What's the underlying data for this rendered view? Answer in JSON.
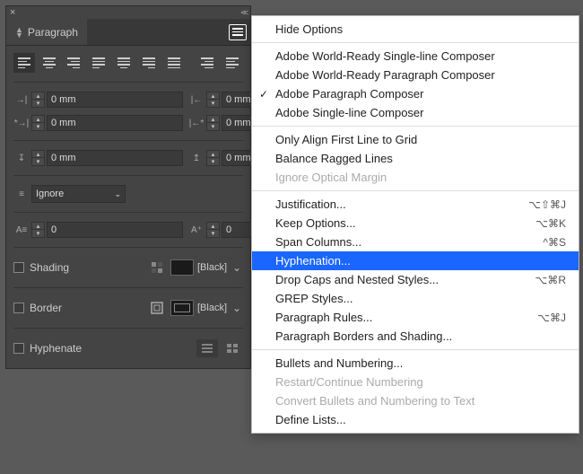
{
  "panel": {
    "title": "Paragraph",
    "indent_left": "0 mm",
    "indent_right": "0 mm",
    "first_line": "0 mm",
    "last_line": "0 mm",
    "space_before": "0 mm",
    "space_after": "0 mm",
    "align_grid": "Ignore",
    "drop_lines": "0",
    "drop_chars": "0",
    "shading_label": "Shading",
    "shading_color": "[Black]",
    "border_label": "Border",
    "border_color": "[Black]",
    "hyphenate_label": "Hyphenate"
  },
  "menu": {
    "items": [
      {
        "label": "Hide Options"
      },
      {
        "sep": true
      },
      {
        "label": "Adobe World-Ready Single-line Composer"
      },
      {
        "label": "Adobe World-Ready Paragraph Composer"
      },
      {
        "label": "Adobe Paragraph Composer",
        "checked": true
      },
      {
        "label": "Adobe Single-line Composer"
      },
      {
        "sep": true
      },
      {
        "label": "Only Align First Line to Grid"
      },
      {
        "label": "Balance Ragged Lines"
      },
      {
        "label": "Ignore Optical Margin",
        "disabled": true
      },
      {
        "sep": true
      },
      {
        "label": "Justification...",
        "shortcut": "⌥⇧⌘J"
      },
      {
        "label": "Keep Options...",
        "shortcut": "⌥⌘K"
      },
      {
        "label": "Span Columns...",
        "shortcut": "^⌘S"
      },
      {
        "label": "Hyphenation...",
        "highlight": true
      },
      {
        "label": "Drop Caps and Nested Styles...",
        "shortcut": "⌥⌘R"
      },
      {
        "label": "GREP Styles..."
      },
      {
        "label": "Paragraph Rules...",
        "shortcut": "⌥⌘J"
      },
      {
        "label": "Paragraph Borders and Shading..."
      },
      {
        "sep": true
      },
      {
        "label": "Bullets and Numbering..."
      },
      {
        "label": "Restart/Continue Numbering",
        "disabled": true
      },
      {
        "label": "Convert Bullets and Numbering to Text",
        "disabled": true
      },
      {
        "label": "Define Lists..."
      }
    ]
  }
}
